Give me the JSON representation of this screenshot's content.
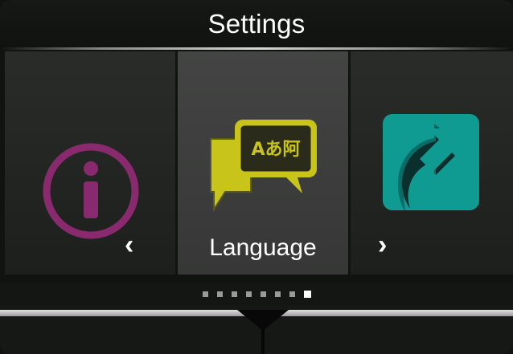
{
  "header": {
    "title": "Settings"
  },
  "carousel": {
    "items": [
      {
        "label": "",
        "icon": "info-icon",
        "color": "#8a2a6e"
      },
      {
        "label": "Language",
        "icon": "language-icon",
        "color": "#c8c41a",
        "glyphs": "Aあ阿"
      },
      {
        "label": "",
        "icon": "share-arrow-icon",
        "color": "#0f9b92"
      }
    ],
    "selected_index": 1,
    "prev_arrow": "‹",
    "next_arrow": "›"
  },
  "pagination": {
    "count": 8,
    "active": 8
  }
}
